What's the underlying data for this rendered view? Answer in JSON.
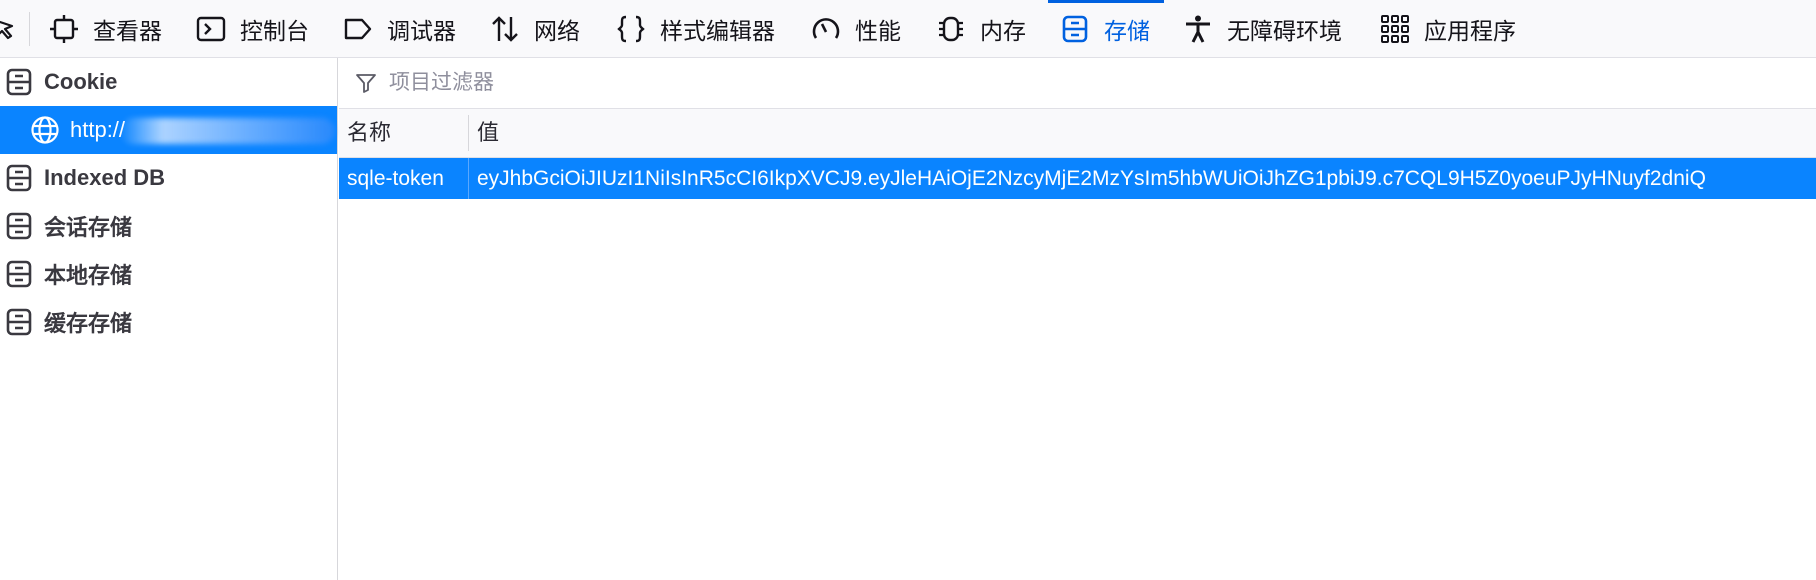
{
  "toolbar": {
    "tabs": [
      {
        "label": "查看器",
        "icon": "inspector-icon"
      },
      {
        "label": "控制台",
        "icon": "console-icon"
      },
      {
        "label": "调试器",
        "icon": "debugger-icon"
      },
      {
        "label": "网络",
        "icon": "network-icon"
      },
      {
        "label": "样式编辑器",
        "icon": "style-editor-icon"
      },
      {
        "label": "性能",
        "icon": "performance-icon"
      },
      {
        "label": "内存",
        "icon": "memory-icon"
      },
      {
        "label": "存储",
        "icon": "storage-icon",
        "selected": true
      },
      {
        "label": "无障碍环境",
        "icon": "accessibility-icon"
      },
      {
        "label": "应用程序",
        "icon": "application-icon"
      }
    ]
  },
  "sidebar": {
    "items": [
      {
        "label": "Cookie",
        "icon": "storage-icon"
      },
      {
        "label": "http://",
        "icon": "globe-icon",
        "selected": true
      },
      {
        "label": "Indexed DB",
        "icon": "storage-icon"
      },
      {
        "label": "会话存储",
        "icon": "storage-icon"
      },
      {
        "label": "本地存储",
        "icon": "storage-icon"
      },
      {
        "label": "缓存存储",
        "icon": "storage-icon"
      }
    ]
  },
  "filter": {
    "placeholder": "项目过滤器"
  },
  "table": {
    "columns": [
      "名称",
      "值"
    ],
    "rows": [
      {
        "name": "sqle-token",
        "value": "eyJhbGciOiJIUzI1NiIsInR5cCI6IkpXVCJ9.eyJleHAiOjE2NzcyMjE2MzYsIm5hbWUiOiJhZG1pbiJ9.c7CQL9H5Z0yoeuPJyHNuyf2dniQ"
      }
    ]
  },
  "colors": {
    "accent": "#0061e0",
    "selection": "#0a84ff"
  }
}
